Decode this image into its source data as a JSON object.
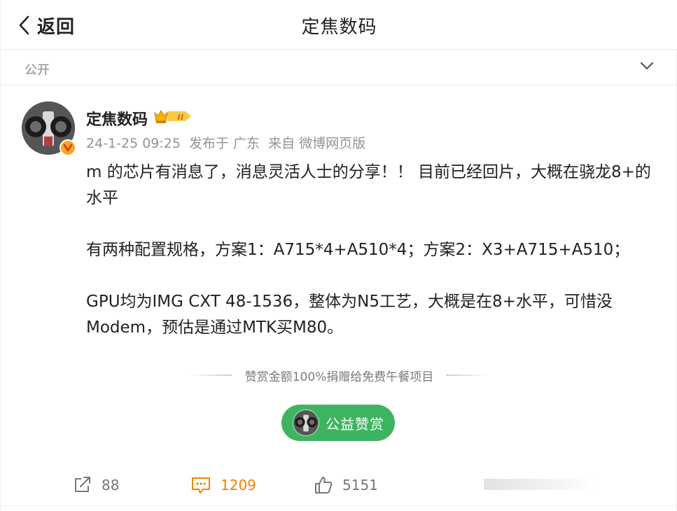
{
  "header": {
    "back_label": "返回",
    "title": "定焦数码"
  },
  "visibility": {
    "label": "公开"
  },
  "post": {
    "author": "定焦数码",
    "vip_level": "II",
    "time": "24-1-25 09:25",
    "location": "发布于 广东",
    "source": "来自 微博网页版",
    "paragraphs": [
      "m 的芯片有消息了，消息灵活人士的分享！！ 目前已经回片，大概在骁龙8+的水平",
      "有两种配置规格，方案1：A715*4+A510*4；方案2：X3+A715+A510；",
      "GPU均为IMG CXT 48-1536，整体为N5工艺，大概是在8+水平，可惜没Modem，预估是通过MTK买M80。"
    ]
  },
  "reward": {
    "note": "赞赏金额100%捐赠给免费午餐项目",
    "button_label": "公益赞赏",
    "color": "#3eb461"
  },
  "actions": {
    "share_count": "88",
    "comment_count": "1209",
    "like_count": "5151",
    "comment_color": "#f08200"
  }
}
